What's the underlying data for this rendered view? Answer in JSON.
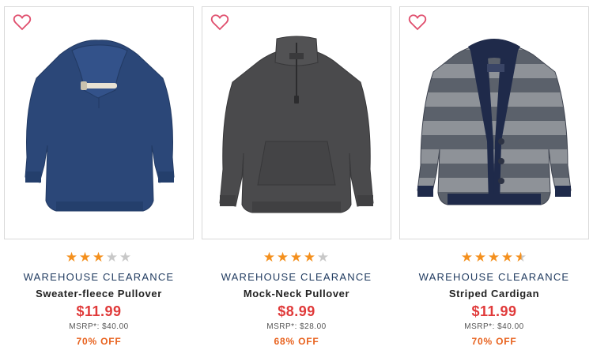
{
  "colors": {
    "heart": "#e04f6e",
    "star_filled": "#f4901e",
    "star_empty": "#c8c8c8",
    "brand_text": "#1f3a5f",
    "price": "#e03a3a",
    "discount": "#e8621e"
  },
  "products": [
    {
      "favorite_icon": "heart-outline-icon",
      "image": "navy sweater-fleece pullover with shawl collar",
      "rating": 3,
      "rating_max": 5,
      "brand": "WAREHOUSE CLEARANCE",
      "name": "Sweater-fleece Pullover",
      "price": "$11.99",
      "msrp": "MSRP*: $40.00",
      "discount": "70% OFF"
    },
    {
      "favorite_icon": "heart-outline-icon",
      "image": "charcoal mock-neck quarter-zip pullover",
      "rating": 4,
      "rating_max": 5,
      "brand": "WAREHOUSE CLEARANCE",
      "name": "Mock-Neck Pullover",
      "price": "$8.99",
      "msrp": "MSRP*: $28.00",
      "discount": "68% OFF"
    },
    {
      "favorite_icon": "heart-outline-icon",
      "image": "gray striped shawl-collar cardigan with navy trim",
      "rating": 4.5,
      "rating_max": 5,
      "brand": "WAREHOUSE CLEARANCE",
      "name": "Striped Cardigan",
      "price": "$11.99",
      "msrp": "MSRP*: $40.00",
      "discount": "70% OFF"
    }
  ]
}
